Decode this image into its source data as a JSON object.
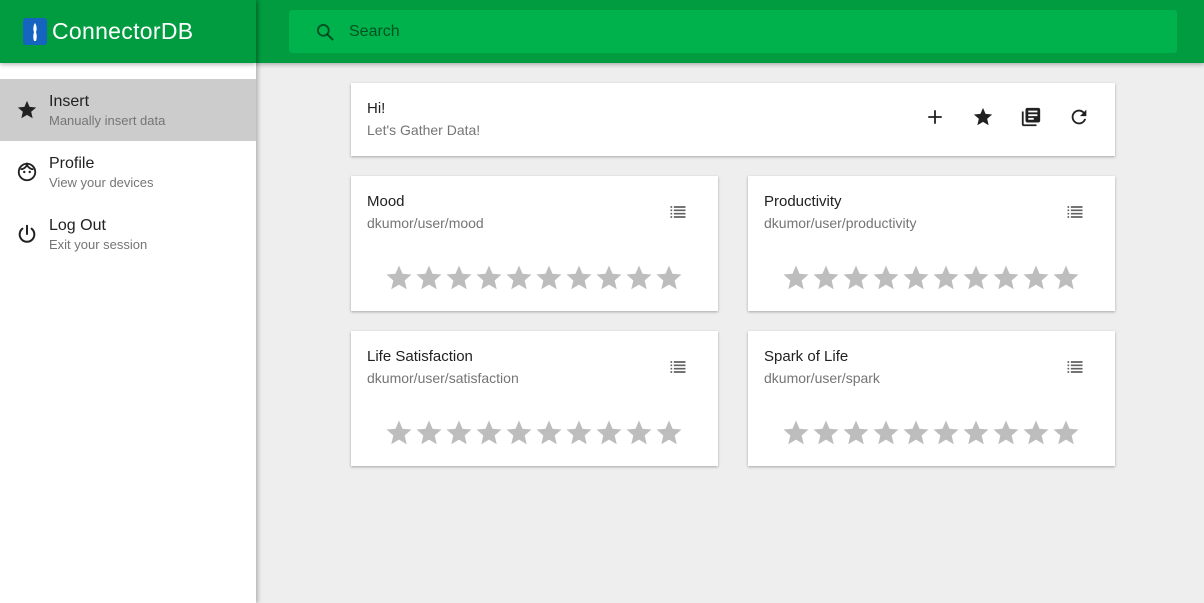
{
  "app": {
    "name": "ConnectorDB"
  },
  "search": {
    "placeholder": "Search"
  },
  "sidebar": {
    "items": [
      {
        "title": "Insert",
        "subtitle": "Manually insert data",
        "icon": "star-icon"
      },
      {
        "title": "Profile",
        "subtitle": "View your devices",
        "icon": "face-icon"
      },
      {
        "title": "Log Out",
        "subtitle": "Exit your session",
        "icon": "power-icon"
      }
    ]
  },
  "header_card": {
    "title": "Hi!",
    "subtitle": "Let's Gather Data!",
    "actions": [
      "add-icon",
      "star-icon",
      "library-books-icon",
      "refresh-icon"
    ]
  },
  "ratings": [
    {
      "title": "Mood",
      "path": "dkumor/user/mood",
      "stars": 10,
      "value": 0
    },
    {
      "title": "Productivity",
      "path": "dkumor/user/productivity",
      "stars": 10,
      "value": 0
    },
    {
      "title": "Life Satisfaction",
      "path": "dkumor/user/satisfaction",
      "stars": 10,
      "value": 0
    },
    {
      "title": "Spark of Life",
      "path": "dkumor/user/spark",
      "stars": 10,
      "value": 0
    }
  ],
  "colors": {
    "primary": "#009c3f",
    "search_bg": "#00b24b",
    "active_nav": "#cccccc",
    "star_empty": "#bdbdbd",
    "logo_blue": "#1565c0"
  }
}
